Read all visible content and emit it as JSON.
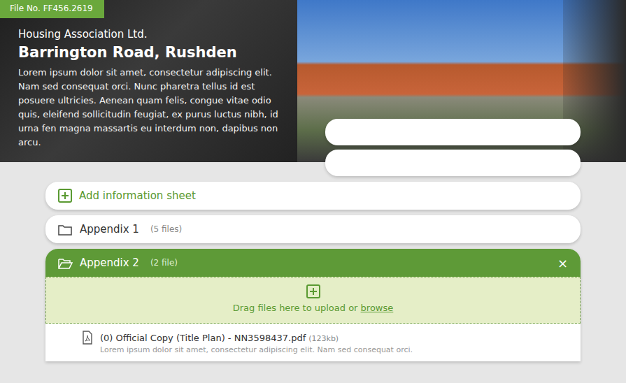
{
  "header": {
    "file_no": "File No. FF456.2619",
    "org": "Housing Association Ltd.",
    "title": "Barrington Road, Rushden",
    "body": "Lorem ipsum dolor sit amet, consectetur adipiscing elit. Nam sed consequat orci. Nunc pharetra tellus id est posuere ultricies. Aenean quam felis, congue vitae odio quis, eleifend sollicitudin feugiat, ex purus luctus nibh, id urna fen magna massartis eu interdum non, dapibus non arcu."
  },
  "add_sheet": {
    "label": "Add information sheet"
  },
  "sections": [
    {
      "name": "Appendix 1",
      "count": "(5 files)",
      "expanded": false
    },
    {
      "name": "Appendix 2",
      "count": "(2 file)",
      "expanded": true,
      "close": "×",
      "dropzone": {
        "text": "Drag files here to upload or",
        "link": "browse"
      },
      "files": [
        {
          "name": "(0) Official Copy (Title Plan) - NN3598437.pdf",
          "size": "(123kb)",
          "description": "Lorem ipsum dolor sit amet, consectetur adipiscing elit. Nam sed consequat orci."
        }
      ]
    }
  ]
}
